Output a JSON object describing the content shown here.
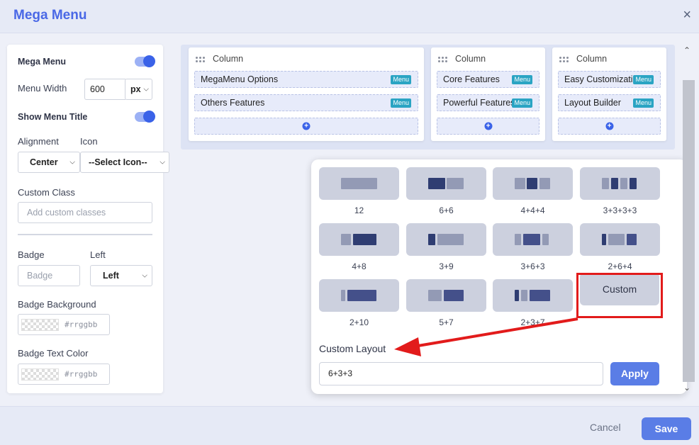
{
  "header": {
    "title": "Mega Menu",
    "close_label": "×"
  },
  "settings": {
    "mega_menu_label": "Mega Menu",
    "mega_menu_enabled": true,
    "menu_width_label": "Menu Width",
    "menu_width_value": "600",
    "menu_width_unit": "px",
    "show_title_label": "Show Menu Title",
    "show_title_enabled": true,
    "alignment_label": "Alignment",
    "alignment_value": "Center",
    "icon_label": "Icon",
    "icon_value": "--Select Icon--",
    "custom_class_label": "Custom Class",
    "custom_class_placeholder": "Add custom classes",
    "badge_label": "Badge",
    "badge_placeholder": "Badge",
    "badge_position_label": "Left",
    "badge_position_value": "Left",
    "badge_bg_label": "Badge Background",
    "badge_bg_placeholder": "#rrggbb",
    "badge_text_color_label": "Badge Text Color",
    "badge_text_color_placeholder": "#rrggbb"
  },
  "columns": [
    {
      "title": "Column",
      "items": [
        {
          "label": "MegaMenu Options",
          "badge": "Menu"
        },
        {
          "label": "Others Features",
          "badge": "Menu"
        }
      ]
    },
    {
      "title": "Column",
      "items": [
        {
          "label": "Core Features",
          "badge": "Menu"
        },
        {
          "label": "Powerful Features",
          "badge": "Menu"
        }
      ]
    },
    {
      "title": "Column",
      "items": [
        {
          "label": "Easy Customization",
          "badge": "Menu"
        },
        {
          "label": "Layout Builder",
          "badge": "Menu"
        }
      ]
    }
  ],
  "layouts": [
    {
      "label": "12"
    },
    {
      "label": "6+6"
    },
    {
      "label": "4+4+4"
    },
    {
      "label": "3+3+3+3"
    },
    {
      "label": "4+8"
    },
    {
      "label": "3+9"
    },
    {
      "label": "3+6+3"
    },
    {
      "label": "2+6+4"
    },
    {
      "label": "2+10"
    },
    {
      "label": "5+7"
    },
    {
      "label": "2+3+7"
    }
  ],
  "custom_label": "Custom",
  "custom_layout": {
    "label": "Custom Layout",
    "value": "6+3+3",
    "apply_label": "Apply"
  },
  "footer": {
    "cancel_label": "Cancel",
    "save_label": "Save"
  },
  "colors": {
    "accent": "#3a62e8",
    "button": "#5a7de6",
    "highlight": "#e21b1b",
    "badge": "#2aa4c3"
  }
}
